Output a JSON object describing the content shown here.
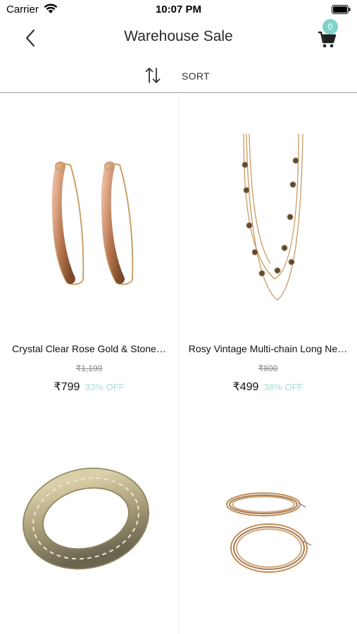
{
  "status_bar": {
    "carrier": "Carrier",
    "time": "10:07 PM"
  },
  "header": {
    "title": "Warehouse Sale",
    "cart_count": "0",
    "accent_color": "#7fd4cb"
  },
  "sort": {
    "label": "SORT"
  },
  "products": [
    {
      "name": "Crystal Clear Rose Gold & Stone…",
      "mrp": "₹1,199",
      "price": "₹799",
      "discount": "33% OFF",
      "image_icon": "rose-gold-hoop-earrings"
    },
    {
      "name": "Rosy Vintage Multi-chain Long Ne…",
      "mrp": "₹800",
      "price": "₹499",
      "discount": "38% OFF",
      "image_icon": "multi-chain-long-necklace"
    },
    {
      "image_icon": "stone-stretch-bracelet"
    },
    {
      "image_icon": "twisted-hoop-earrings"
    }
  ]
}
